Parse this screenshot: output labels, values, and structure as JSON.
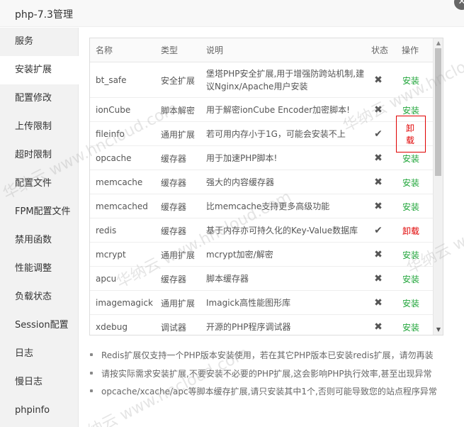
{
  "window": {
    "title": "php-7.3管理",
    "close_icon": "close-icon"
  },
  "sidebar": {
    "items": [
      {
        "label": "服务"
      },
      {
        "label": "安装扩展"
      },
      {
        "label": "配置修改"
      },
      {
        "label": "上传限制"
      },
      {
        "label": "超时限制"
      },
      {
        "label": "配置文件"
      },
      {
        "label": "FPM配置文件"
      },
      {
        "label": "禁用函数"
      },
      {
        "label": "性能调整"
      },
      {
        "label": "负载状态"
      },
      {
        "label": "Session配置"
      },
      {
        "label": "日志"
      },
      {
        "label": "慢日志"
      },
      {
        "label": "phpinfo"
      }
    ],
    "active_index": 1
  },
  "table": {
    "headers": {
      "name": "名称",
      "type": "类型",
      "desc": "说明",
      "status": "状态",
      "op": "操作"
    },
    "rows": [
      {
        "name": "bt_safe",
        "type": "安全扩展",
        "desc": "堡塔PHP安全扩展,用于增强防跨站机制,建议Nginx/Apache用户安装",
        "status": "✖",
        "op": "安装"
      },
      {
        "name": "ionCube",
        "type": "脚本解密",
        "desc": "用于解密ionCube Encoder加密脚本!",
        "status": "✖",
        "op": "安装"
      },
      {
        "name": "fileinfo",
        "type": "通用扩展",
        "desc": "若可用内存小于1G，可能会安装不上",
        "status": "✔",
        "op": "卸载"
      },
      {
        "name": "opcache",
        "type": "缓存器",
        "desc": "用于加速PHP脚本!",
        "status": "✖",
        "op": "安装"
      },
      {
        "name": "memcache",
        "type": "缓存器",
        "desc": "强大的内容缓存器",
        "status": "✖",
        "op": "安装"
      },
      {
        "name": "memcached",
        "type": "缓存器",
        "desc": "比memcache支持更多高级功能",
        "status": "✖",
        "op": "安装"
      },
      {
        "name": "redis",
        "type": "缓存器",
        "desc": "基于内存亦可持久化的Key-Value数据库",
        "status": "✔",
        "op": "卸载"
      },
      {
        "name": "mcrypt",
        "type": "通用扩展",
        "desc": "mcrypt加密/解密",
        "status": "✖",
        "op": "安装"
      },
      {
        "name": "apcu",
        "type": "缓存器",
        "desc": "脚本缓存器",
        "status": "✖",
        "op": "安装"
      },
      {
        "name": "imagemagick",
        "type": "通用扩展",
        "desc": "Imagick高性能图形库",
        "status": "✖",
        "op": "安装"
      },
      {
        "name": "xdebug",
        "type": "调试器",
        "desc": "开源的PHP程序调试器",
        "status": "✖",
        "op": "安装"
      }
    ]
  },
  "notes": [
    "Redis扩展仅支持一个PHP版本安装使用，若在其它PHP版本已安装redis扩展，请勿再装",
    "请按实际需求安装扩展,不要安装不必要的PHP扩展,这会影响PHP执行效率,甚至出现异常",
    "opcache/xcache/apc等脚本缓存扩展,请只安装其中1个,否则可能导致您的站点程序异常"
  ],
  "colors": {
    "install": "#20a53a",
    "uninstall": "#e00000",
    "highlight_border": "#e00000"
  },
  "watermark": "华纳云 www.hncloud.com"
}
